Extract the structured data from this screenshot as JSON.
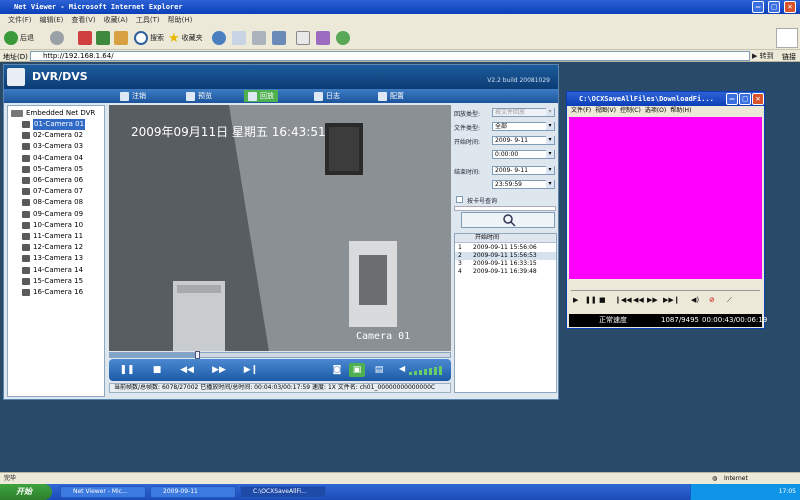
{
  "window": {
    "title": "Net Viewer - Microsoft Internet Explorer"
  },
  "ie_menu": [
    "文件(F)",
    "编辑(E)",
    "查看(V)",
    "收藏(A)",
    "工具(T)",
    "帮助(H)"
  ],
  "toolbar": {
    "back": "后退",
    "search": "搜索",
    "favorites": "收藏夹"
  },
  "address": {
    "label": "地址(D)",
    "url": "http://192.168.1.64/",
    "go": "转到",
    "links": "链接"
  },
  "app": {
    "name": "DVR/DVS",
    "version": "V2.2  build 20081029",
    "nav": [
      "注销",
      "预览",
      "回放",
      "日志",
      "配置"
    ],
    "tree_root": "Embedded Net DVR",
    "cameras": [
      "01-Camera 01",
      "02-Camera 02",
      "03-Camera 03",
      "04-Camera 04",
      "05-Camera 05",
      "06-Camera 06",
      "07-Camera 07",
      "08-Camera 08",
      "09-Camera 09",
      "10-Camera 10",
      "11-Camera 11",
      "12-Camera 12",
      "13-Camera 13",
      "14-Camera 14",
      "15-Camera 15",
      "16-Camera 16"
    ],
    "osd_datetime": "2009年09月11日  星期五  16:43:51",
    "osd_camera": "Camera 01",
    "seek_progress": 0.255,
    "status_text": "当前帧数/总帧数: 6078/27002   已播放时间/总时间: 00:04:03/00:17:59   速度: 1X   文件名: ch01_00000000000000C"
  },
  "search": {
    "record_type_label": "回放类型:",
    "record_type_value": "按文件回放",
    "file_type_label": "文件类型:",
    "file_type_value": "全部",
    "start_label": "开始时间:",
    "start_date": "2009- 9-11",
    "start_time": "0:00:00",
    "end_label": "结束时间:",
    "end_date": "2009- 9-11",
    "end_time": "23:59:59",
    "card_label": "按卡号查询",
    "results_header": "开始时间",
    "results": [
      {
        "index": "1",
        "time": "2009-09-11 15:56:06"
      },
      {
        "index": "2",
        "time": "2009-09-11 15:56:53"
      },
      {
        "index": "3",
        "time": "2009-09-11 16:33:15"
      },
      {
        "index": "4",
        "time": "2009-09-11 16:39:48"
      }
    ]
  },
  "ocx": {
    "title": "C:\\OCXSaveAllFiles\\DownloadFi...",
    "menu": [
      "文件(F)",
      "视图(V)",
      "控制(C)",
      "选项(O)",
      "帮助(H)"
    ],
    "speed": "正常速度",
    "frames": "1087/9495",
    "time": "00:00:43/00:06:19"
  },
  "ie_status": {
    "left": "完毕",
    "right": "Internet"
  },
  "taskbar": {
    "start": "开始",
    "tasks": [
      "Net Viewer - Mic...",
      "2009-09-11",
      "C:\\OCXSaveAllFi..."
    ],
    "clock": "17:05"
  },
  "colors": {
    "brand": "#1c5c9c",
    "ocx_video": "#ff00ff",
    "accent_green": "#4fb04f"
  }
}
